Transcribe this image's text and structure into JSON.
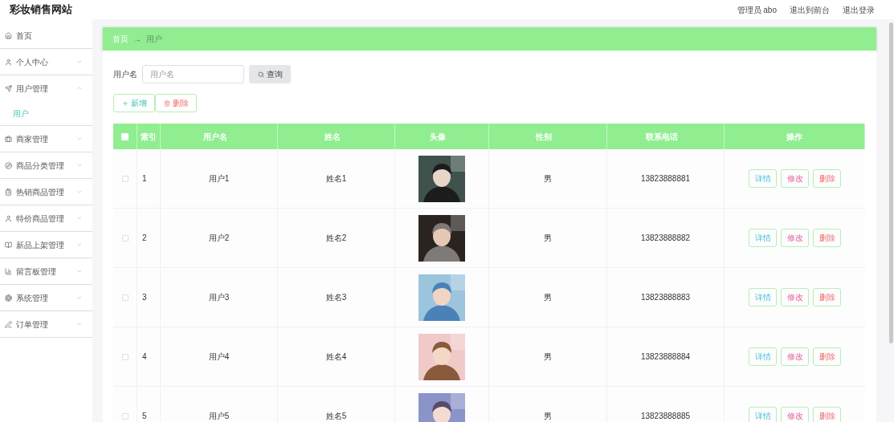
{
  "header": {
    "title": "彩妆销售网站",
    "links": [
      "管理员 abo",
      "退出到前台",
      "退出登录"
    ]
  },
  "sidebar": {
    "items": [
      {
        "label": "首页"
      },
      {
        "label": "个人中心",
        "expanded": false
      },
      {
        "label": "用户管理",
        "expanded": true,
        "children": [
          {
            "label": "用户",
            "selected": true
          }
        ]
      },
      {
        "label": "商家管理",
        "expanded": false
      },
      {
        "label": "商品分类管理",
        "expanded": false
      },
      {
        "label": "热销商品管理",
        "expanded": false
      },
      {
        "label": "特价商品管理",
        "expanded": false
      },
      {
        "label": "新品上架管理",
        "expanded": false
      },
      {
        "label": "留言板管理",
        "expanded": false
      },
      {
        "label": "系统管理",
        "expanded": false
      },
      {
        "label": "订单管理",
        "expanded": false
      }
    ]
  },
  "breadcrumb": [
    "首页",
    "→",
    "用户"
  ],
  "search": {
    "label": "用户名",
    "placeholder": "用户名",
    "button": "查询"
  },
  "actions": [
    {
      "label": "新增",
      "kind": "add"
    },
    {
      "label": "删除",
      "kind": "delete"
    }
  ],
  "table": {
    "columns": [
      {
        "kind": "check",
        "checked": false
      },
      {
        "label": "索引",
        "sortable": false
      },
      {
        "label": "用户名",
        "sortable": true
      },
      {
        "label": "姓名",
        "sortable": true
      },
      {
        "label": "头像",
        "sortable": true
      },
      {
        "label": "性别",
        "sortable": true
      },
      {
        "label": "联系电话",
        "sortable": true
      },
      {
        "label": "操作",
        "sortable": false
      }
    ],
    "rows": [
      {
        "checked": false,
        "index": "1",
        "username": "用户1",
        "name": "姓名1",
        "gender": "男",
        "phone": "13823888881",
        "buttons": [
          "详情",
          "修改",
          "删除"
        ]
      },
      {
        "checked": false,
        "index": "2",
        "username": "用户2",
        "name": "姓名2",
        "gender": "男",
        "phone": "13823888882",
        "buttons": [
          "详情",
          "修改",
          "删除"
        ]
      },
      {
        "checked": false,
        "index": "3",
        "username": "用户3",
        "name": "姓名3",
        "gender": "男",
        "phone": "13823888883",
        "buttons": [
          "详情",
          "修改",
          "删除"
        ]
      },
      {
        "checked": false,
        "index": "4",
        "username": "用户4",
        "name": "姓名4",
        "gender": "男",
        "phone": "13823888884",
        "buttons": [
          "详情",
          "修改",
          "删除"
        ]
      },
      {
        "checked": false,
        "index": "5",
        "username": "用户5",
        "name": "姓名5",
        "gender": "男",
        "phone": "13823888885",
        "buttons": [
          "详情",
          "修改",
          "删除"
        ]
      }
    ]
  }
}
